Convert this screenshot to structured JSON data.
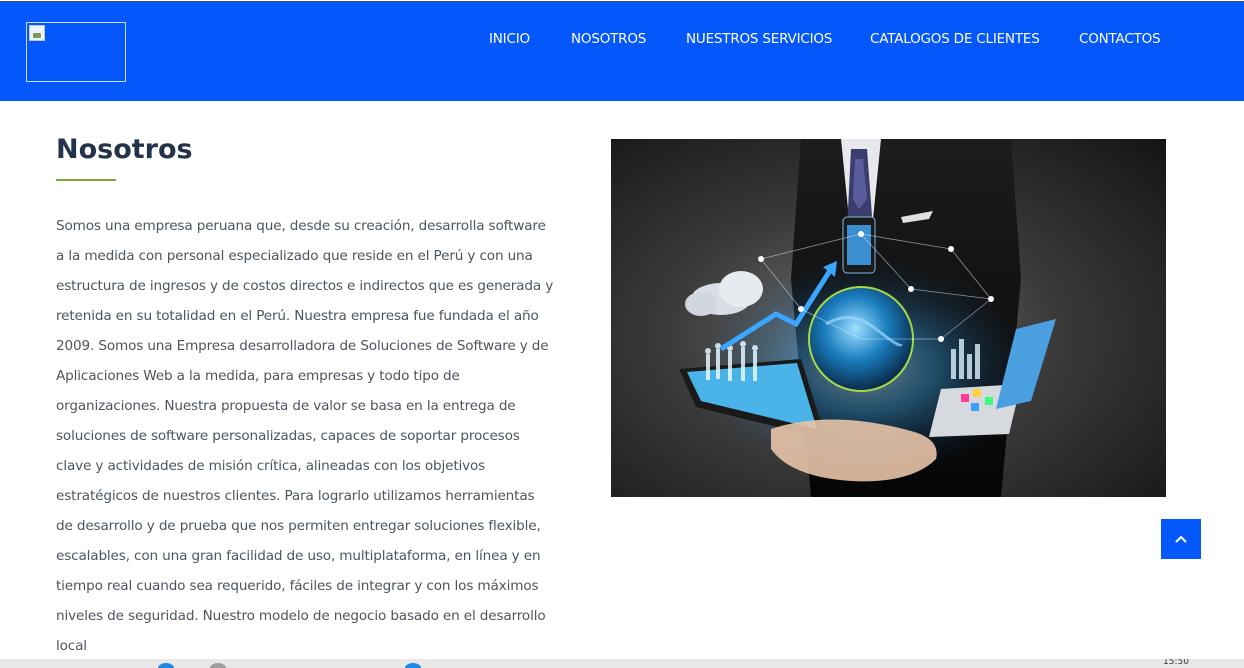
{
  "header": {
    "nav": [
      {
        "id": "inicio",
        "label": "INICIO"
      },
      {
        "id": "nosotros",
        "label": "NOSOTROS"
      },
      {
        "id": "servicios",
        "label": "NUESTROS SERVICIOS"
      },
      {
        "id": "catalogos",
        "label": "CATALOGOS DE CLIENTES"
      },
      {
        "id": "contactos",
        "label": "CONTACTOS"
      }
    ],
    "background_color": "#0357fb",
    "logo_icon": "broken-image-icon"
  },
  "main": {
    "title": "Nosotros",
    "accent_color": "#7aa63c",
    "paragraph": "Somos una empresa peruana que, desde su creación, desarrolla software a la medida con personal especializado que reside en el Perú y con una estructura de ingresos y de costos directos e indirectos que es generada y retenida en su totalidad en el Perú. Nuestra empresa fue fundada el año 2009. Somos una Empresa desarrolladora de Soluciones de Software y de Aplicaciones Web a la medida, para empresas y todo tipo de organizaciones. Nuestra propuesta de valor se basa en la entrega de soluciones de software personalizadas, capaces de soportar procesos clave y actividades de misión crítica, alineadas con los objetivos estratégicos de nuestros clientes. Para lograrlo utilizamos herramientas de desarrollo y de prueba que nos permiten entregar soluciones flexible, escalables, con una gran facilidad de uso, multiplataforma, en línea y en tiempo real cuando sea requerido, fáciles de integrar y con los máximos niveles de seguridad. Nuestro modelo de negocio basado en el desarrollo local"
  },
  "back_to_top": {
    "icon": "chevron-up-icon",
    "color": "#0357fb"
  },
  "taskbar": {
    "clock": "15:50"
  }
}
